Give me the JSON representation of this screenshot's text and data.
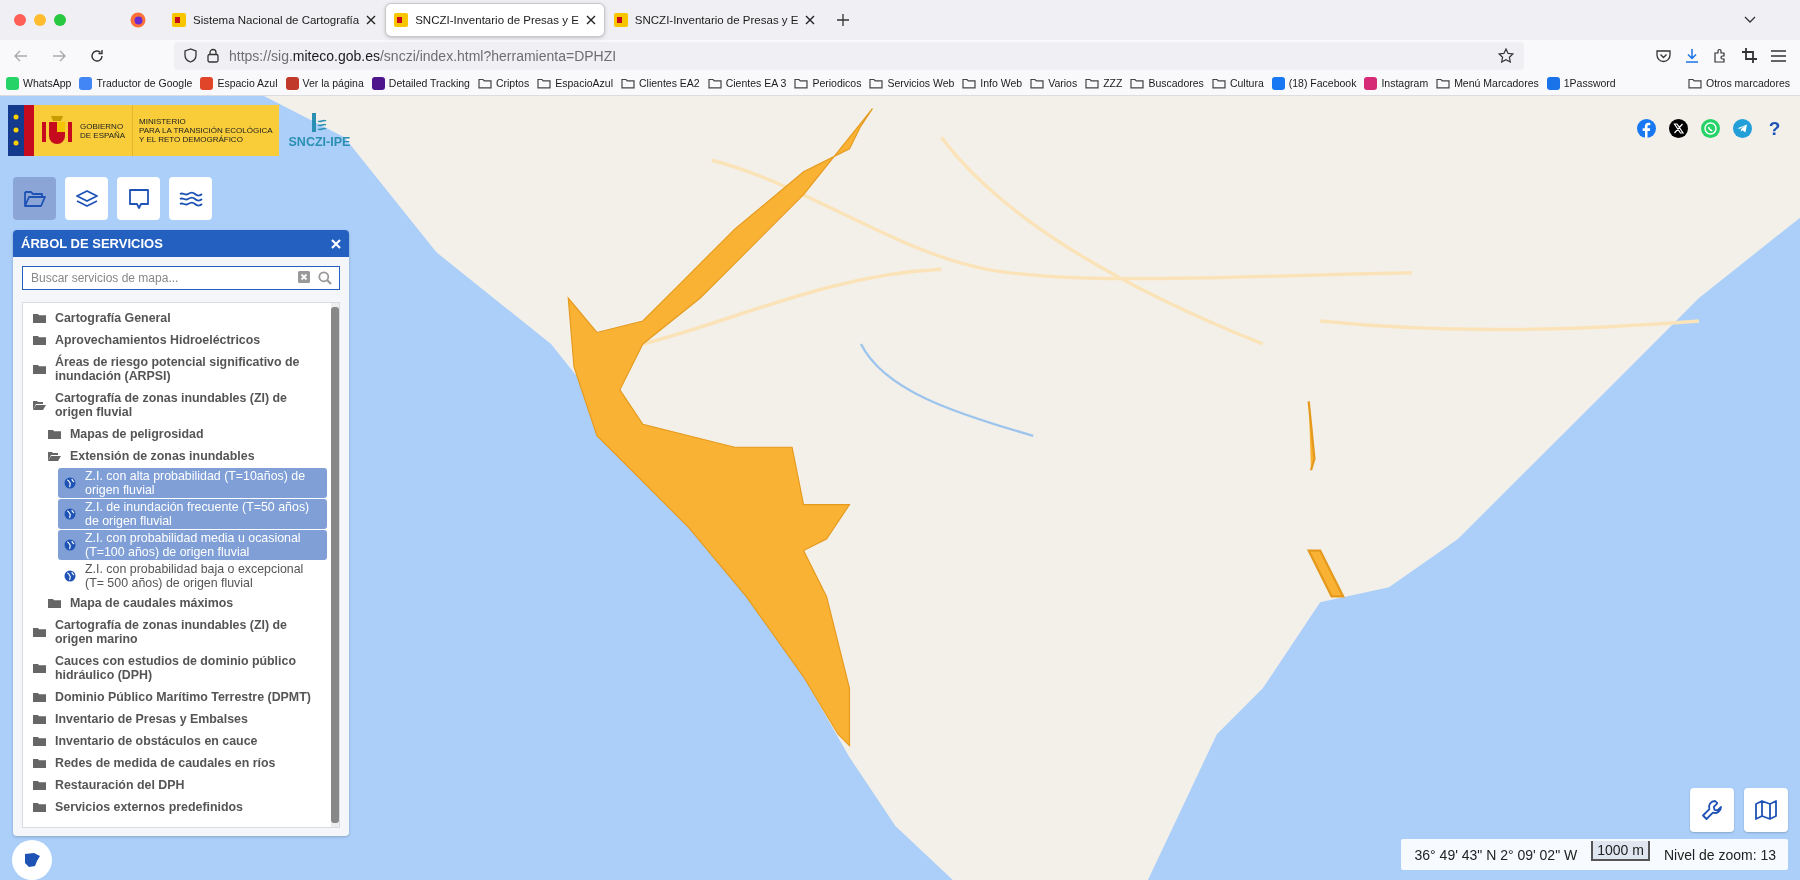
{
  "browser": {
    "tabs": [
      {
        "title": "Sistema Nacional de Cartografía",
        "selected": false
      },
      {
        "title": "SNCZI-Inventario de Presas y E",
        "selected": true
      },
      {
        "title": "SNCZI-Inventario de Presas y E",
        "selected": false
      }
    ],
    "url": {
      "scheme": "https://sig.",
      "domain": "miteco.gob.es",
      "path": "/snczi/index.html?herramienta=DPHZI"
    },
    "bookmarks": [
      {
        "label": "WhatsApp",
        "kind": "site",
        "color": "#25d366"
      },
      {
        "label": "Traductor de Google",
        "kind": "site",
        "color": "#4285f4"
      },
      {
        "label": "Espacio Azul",
        "kind": "site",
        "color": "#e0452a"
      },
      {
        "label": "Ver la página",
        "kind": "site",
        "color": "#c0392b"
      },
      {
        "label": "Detailed Tracking",
        "kind": "site",
        "color": "#4d148c"
      },
      {
        "label": "Criptos",
        "kind": "folder"
      },
      {
        "label": "EspacioAzul",
        "kind": "folder"
      },
      {
        "label": "Clientes EA2",
        "kind": "folder"
      },
      {
        "label": "Cientes EA 3",
        "kind": "folder"
      },
      {
        "label": "Periodicos",
        "kind": "folder"
      },
      {
        "label": "Servicios Web",
        "kind": "folder"
      },
      {
        "label": "Info Web",
        "kind": "folder"
      },
      {
        "label": "Varios",
        "kind": "folder"
      },
      {
        "label": "ZZZ",
        "kind": "folder"
      },
      {
        "label": "Buscadores",
        "kind": "folder"
      },
      {
        "label": "Cultura",
        "kind": "folder"
      },
      {
        "label": "(18) Facebook",
        "kind": "site",
        "color": "#1877f2"
      },
      {
        "label": "Instagram",
        "kind": "site",
        "color": "#d62976"
      },
      {
        "label": "Menú Marcadores",
        "kind": "folder"
      },
      {
        "label": "1Password",
        "kind": "site",
        "color": "#1a73e8"
      }
    ],
    "other_bookmarks": "Otros marcadores"
  },
  "header": {
    "government": "GOBIERNO DE ESPAÑA",
    "ministry_lines": [
      "MINISTERIO",
      "PARA LA TRANSICIÓN ECOLÓGICA",
      "Y EL RETO DEMOGRÁFICO"
    ],
    "app_name": "SNCZI-IPE"
  },
  "share_buttons": [
    {
      "kind": "facebook"
    },
    {
      "kind": "x"
    },
    {
      "kind": "whatsapp"
    },
    {
      "kind": "telegram"
    }
  ],
  "help_button": "?",
  "tools": [
    {
      "kind": "folder",
      "selected": true
    },
    {
      "kind": "layers",
      "selected": false
    },
    {
      "kind": "comment",
      "selected": false
    },
    {
      "kind": "water",
      "selected": false
    }
  ],
  "panel": {
    "title": "ÁRBOL DE SERVICIOS",
    "search": {
      "placeholder": "Buscar servicios de mapa..."
    },
    "tree": [
      {
        "label": "Cartografía General",
        "kind": "folder",
        "expanded": false
      },
      {
        "label": "Aprovechamientos Hidroeléctricos",
        "kind": "folder",
        "expanded": false
      },
      {
        "label": "Áreas de riesgo potencial significativo de inundación (ARPSI)",
        "kind": "folder",
        "expanded": false
      },
      {
        "label": "Cartografía de zonas inundables (ZI) de origen fluvial",
        "kind": "folder",
        "expanded": true,
        "children": [
          {
            "label": "Mapas de peligrosidad",
            "kind": "folder",
            "expanded": false
          },
          {
            "label": "Extensión de zonas inundables",
            "kind": "folder",
            "expanded": true,
            "children": [
              {
                "label": "Z.I. con alta probabilidad (T=10años) de origen fluvial",
                "kind": "layer",
                "selected": true
              },
              {
                "label": "Z.I. de inundación frecuente (T=50 años) de origen fluvial",
                "kind": "layer",
                "selected": true
              },
              {
                "label": "Z.I. con probabilidad media u ocasional (T=100 años) de origen fluvial",
                "kind": "layer",
                "selected": true
              },
              {
                "label": "Z.I. con probabilidad baja o excepcional (T= 500 años) de origen fluvial",
                "kind": "layer",
                "selected": false
              }
            ]
          },
          {
            "label": "Mapa de caudales máximos",
            "kind": "folder",
            "expanded": false
          }
        ]
      },
      {
        "label": "Cartografía de zonas inundables (ZI) de origen marino",
        "kind": "folder",
        "expanded": false
      },
      {
        "label": "Cauces con estudios de dominio público hidráulico (DPH)",
        "kind": "folder",
        "expanded": false
      },
      {
        "label": "Dominio Público Marítimo Terrestre (DPMT)",
        "kind": "folder",
        "expanded": false
      },
      {
        "label": "Inventario de Presas y Embalses",
        "kind": "folder",
        "expanded": false
      },
      {
        "label": "Inventario de obstáculos en cauce",
        "kind": "folder",
        "expanded": false
      },
      {
        "label": "Redes de medida de caudales en ríos",
        "kind": "folder",
        "expanded": false
      },
      {
        "label": "Restauración del DPH",
        "kind": "folder",
        "expanded": false
      },
      {
        "label": "Servicios externos predefinidos",
        "kind": "folder",
        "expanded": false
      }
    ]
  },
  "map_buttons": [
    {
      "kind": "wrench"
    },
    {
      "kind": "map"
    }
  ],
  "status": {
    "coordinates": "36° 49' 43\" N 2° 09' 02\" W",
    "scale": "1000 m",
    "zoom": "Nivel de zoom: 13"
  }
}
